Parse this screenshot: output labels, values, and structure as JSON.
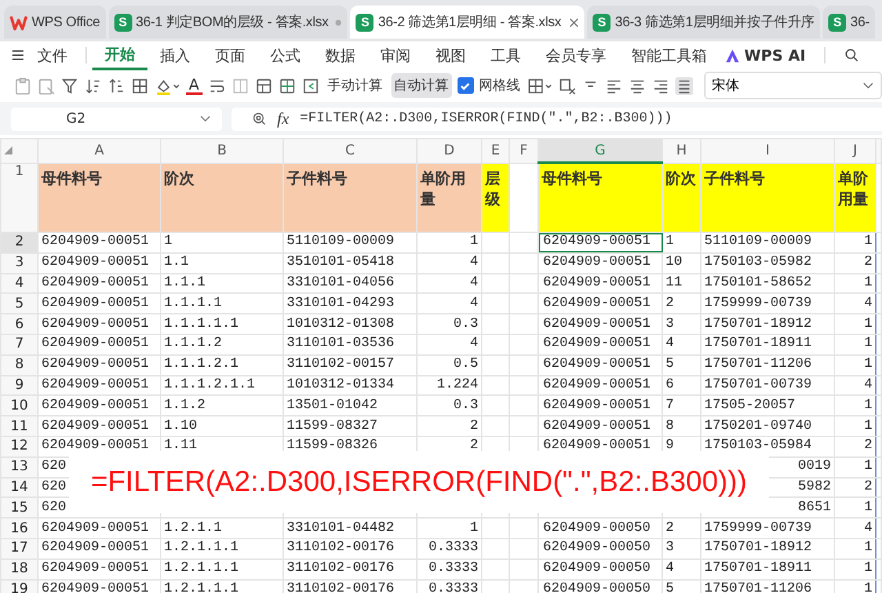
{
  "tabs": [
    {
      "kind": "home",
      "label": "WPS Office",
      "selected": false
    },
    {
      "kind": "sheet",
      "badge": "S",
      "label": "36-1 判定BOM的层级 - 答案.xlsx",
      "selected": false,
      "modified": true
    },
    {
      "kind": "sheet",
      "badge": "S",
      "label": "36-2 筛选第1层明细 - 答案.xlsx",
      "selected": true
    },
    {
      "kind": "sheet",
      "badge": "S",
      "label": "36-3 筛选第1层明细并按子件升序",
      "selected": false
    },
    {
      "kind": "sheet",
      "badge": "S",
      "label": "36-",
      "selected": false
    }
  ],
  "menu": [
    {
      "label": "文件",
      "kind": "file",
      "selected": false
    },
    {
      "label": "开始",
      "selected": true
    },
    {
      "label": "插入",
      "selected": false
    },
    {
      "label": "页面",
      "selected": false
    },
    {
      "label": "公式",
      "selected": false
    },
    {
      "label": "数据",
      "selected": false
    },
    {
      "label": "审阅",
      "selected": false
    },
    {
      "label": "视图",
      "selected": false
    },
    {
      "label": "工具",
      "selected": false
    },
    {
      "label": "会员专享",
      "selected": false
    },
    {
      "label": "智能工具箱",
      "selected": false
    },
    {
      "label": "WPS AI",
      "kind": "ai",
      "selected": false
    }
  ],
  "toolbar": {
    "font_color_glyph": "A",
    "buttons": [
      {
        "label": "手动计算",
        "selected": false
      },
      {
        "label": "自动计算",
        "selected": true
      }
    ],
    "gridlines": {
      "label": "网格线",
      "checked": true
    },
    "font": "宋体"
  },
  "formula_bar": {
    "name_box": "G2",
    "fx": "fx",
    "formula": "=FILTER(A2:.D300,ISERROR(FIND(\".\",B2:.B300)))"
  },
  "sheet": {
    "columns": [
      {
        "label": "A",
        "selected": false
      },
      {
        "label": "B",
        "selected": false
      },
      {
        "label": "C",
        "selected": false
      },
      {
        "label": "D",
        "selected": false
      },
      {
        "label": "E",
        "selected": false
      },
      {
        "label": "F",
        "selected": false
      },
      {
        "label": "G",
        "selected": true
      },
      {
        "label": "H",
        "selected": false
      },
      {
        "label": "I",
        "selected": false
      },
      {
        "label": "J",
        "selected": false
      }
    ],
    "header_row": {
      "number": "1",
      "cells": {
        "A": {
          "text": "母件料号",
          "color": "#f8cbad"
        },
        "B": {
          "text": "阶次",
          "color": "#f8cbad"
        },
        "C": {
          "text": "子件料号",
          "color": "#f8cbad"
        },
        "D": {
          "text": "单阶用量",
          "color": "#f8cbad"
        },
        "E": {
          "text": "层级",
          "color": "#ffff00"
        },
        "G": {
          "text": "母件料号",
          "color": "#ffff00"
        },
        "H": {
          "text": "阶次",
          "color": "#ffff00"
        },
        "I": {
          "text": "子件料号",
          "color": "#ffff00"
        },
        "J": {
          "text": "单阶用量",
          "color": "#ffff00"
        }
      }
    },
    "rows": [
      {
        "number": "2",
        "selected": true,
        "kind": "normal",
        "cells": {
          "A": "6204909-00051",
          "B": "1",
          "C": "5110109-00009",
          "D": "1",
          "G": "6204909-00051",
          "H": "1",
          "I": "5110109-00009",
          "J": "1"
        }
      },
      {
        "number": "3",
        "selected": false,
        "kind": "normal",
        "cells": {
          "A": "6204909-00051",
          "B": "1.1",
          "C": "3510101-05418",
          "D": "4",
          "G": "6204909-00051",
          "H": "10",
          "I": "1750103-05982",
          "J": "2"
        }
      },
      {
        "number": "4",
        "selected": false,
        "kind": "normal",
        "cells": {
          "A": "6204909-00051",
          "B": "1.1.1",
          "C": "3310101-04056",
          "D": "4",
          "G": "6204909-00051",
          "H": "11",
          "I": "1750101-58652",
          "J": "1"
        }
      },
      {
        "number": "5",
        "selected": false,
        "kind": "normal",
        "cells": {
          "A": "6204909-00051",
          "B": "1.1.1.1",
          "C": "3310101-04293",
          "D": "4",
          "G": "6204909-00051",
          "H": "2",
          "I": "1759999-00739",
          "J": "4"
        }
      },
      {
        "number": "6",
        "selected": false,
        "kind": "normal",
        "cells": {
          "A": "6204909-00051",
          "B": "1.1.1.1.1",
          "C": "1010312-01308",
          "D": "0.3",
          "G": "6204909-00051",
          "H": "3",
          "I": "1750701-18912",
          "J": "1"
        }
      },
      {
        "number": "7",
        "selected": false,
        "kind": "normal",
        "cells": {
          "A": "6204909-00051",
          "B": "1.1.1.2",
          "C": "3110101-03536",
          "D": "4",
          "G": "6204909-00051",
          "H": "4",
          "I": "1750701-18911",
          "J": "1"
        }
      },
      {
        "number": "8",
        "selected": false,
        "kind": "normal",
        "cells": {
          "A": "6204909-00051",
          "B": "1.1.1.2.1",
          "C": "3110102-00157",
          "D": "0.5",
          "G": "6204909-00051",
          "H": "5",
          "I": "1750701-11206",
          "J": "1"
        }
      },
      {
        "number": "9",
        "selected": false,
        "kind": "normal",
        "cells": {
          "A": "6204909-00051",
          "B": "1.1.1.2.1.1",
          "C": "1010312-01334",
          "D": "1.224",
          "G": "6204909-00051",
          "H": "6",
          "I": "1750701-00739",
          "J": "4"
        }
      },
      {
        "number": "10",
        "selected": false,
        "kind": "normal",
        "cells": {
          "A": "6204909-00051",
          "B": "1.1.2",
          "C": "13501-01042",
          "D": "0.3",
          "G": "6204909-00051",
          "H": "7",
          "I": "17505-20057",
          "J": "1"
        }
      },
      {
        "number": "11",
        "selected": false,
        "kind": "normal",
        "cells": {
          "A": "6204909-00051",
          "B": "1.10",
          "C": "11599-08327",
          "D": "2",
          "G": "6204909-00051",
          "H": "8",
          "I": "1750201-09740",
          "J": "1"
        }
      },
      {
        "number": "12",
        "selected": false,
        "kind": "normal",
        "cells": {
          "A": "6204909-00051",
          "B": "1.11",
          "C": "11599-08326",
          "D": "2",
          "G": "6204909-00051",
          "H": "9",
          "I": "1750103-05984",
          "J": "2"
        }
      },
      {
        "number": "13",
        "selected": false,
        "kind": "covered",
        "cells": {
          "A": "620",
          "I": "0019",
          "J": "1"
        }
      },
      {
        "number": "14",
        "selected": false,
        "kind": "covered",
        "cells": {
          "A": "620",
          "I": "5982",
          "J": "2"
        }
      },
      {
        "number": "15",
        "selected": false,
        "kind": "covered",
        "cells": {
          "A": "620",
          "I": "8651",
          "J": "1"
        }
      },
      {
        "number": "16",
        "selected": false,
        "kind": "normal",
        "cells": {
          "A": "6204909-00051",
          "B": "1.2.1.1",
          "C": "3310101-04482",
          "D": "1",
          "G": "6204909-00050",
          "H": "2",
          "I": "1759999-00739",
          "J": "4"
        }
      },
      {
        "number": "17",
        "selected": false,
        "kind": "normal",
        "cells": {
          "A": "6204909-00051",
          "B": "1.2.1.1.1",
          "C": "3110102-00176",
          "D": "0.3333",
          "G": "6204909-00050",
          "H": "3",
          "I": "1750701-18912",
          "J": "1"
        }
      },
      {
        "number": "18",
        "selected": false,
        "kind": "normal",
        "cells": {
          "A": "6204909-00051",
          "B": "1.2.1.1.1",
          "C": "3110102-00176",
          "D": "0.3333",
          "G": "6204909-00050",
          "H": "4",
          "I": "1750701-18911",
          "J": "1"
        }
      },
      {
        "number": "19",
        "selected": false,
        "kind": "normal",
        "cells": {
          "A": "6204909-00051",
          "B": "1.2.1.1.1",
          "C": "3110102-00176",
          "D": "0.3333",
          "G": "6204909-00050",
          "H": "5",
          "I": "1750701-11206",
          "J": "1"
        }
      }
    ]
  },
  "overlay_formula": "=FILTER(A2:.D300,ISERROR(FIND(\".\",B2:.B300)))"
}
